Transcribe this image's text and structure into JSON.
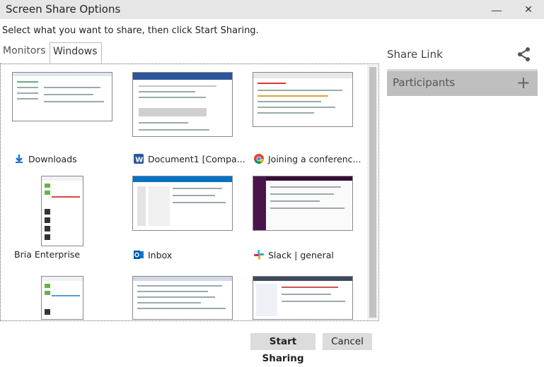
{
  "window": {
    "title": "Screen Share Options",
    "minimize_glyph": "—",
    "close_glyph": "✕"
  },
  "instructions": "Select what you want to share, then click Start Sharing.",
  "tabs": [
    {
      "label": "Monitors"
    },
    {
      "label": "Windows"
    }
  ],
  "windows": [
    {
      "label": "Downloads",
      "icon": "download-arrow-icon",
      "color": "#1e73d8"
    },
    {
      "label": "Document1 [Compa...",
      "icon": "word-icon",
      "color": "#2b579a"
    },
    {
      "label": "Joining a conferenc...",
      "icon": "chrome-icon",
      "color": "#4285f4"
    },
    {
      "label": "Bria Enterprise",
      "icon": "",
      "color": ""
    },
    {
      "label": "Inbox",
      "icon": "outlook-icon",
      "color": "#0072c6"
    },
    {
      "label": "Slack | general",
      "icon": "slack-icon",
      "color": "#4a154b"
    }
  ],
  "side": {
    "share_link_label": "Share Link",
    "participants_label": "Participants",
    "participants_add_glyph": "+"
  },
  "buttons": {
    "start_label": "Start Sharing",
    "cancel_label": "Cancel"
  }
}
